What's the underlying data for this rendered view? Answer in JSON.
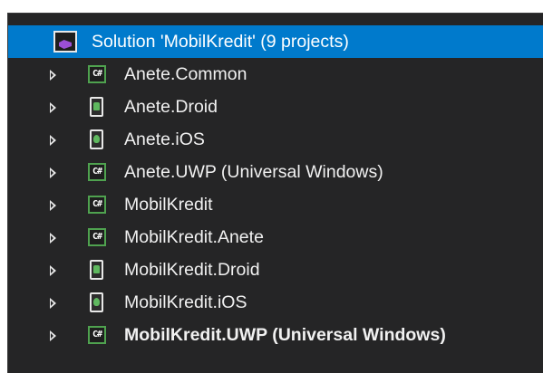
{
  "solution": {
    "label": "Solution 'MobilKredit' (9 projects)",
    "icon": "visual-studio-solution-icon"
  },
  "projects": [
    {
      "label": "Anete.Common",
      "icon": "csharp-project-icon",
      "bold": false
    },
    {
      "label": "Anete.Droid",
      "icon": "android-project-icon",
      "bold": false
    },
    {
      "label": "Anete.iOS",
      "icon": "ios-project-icon",
      "bold": false
    },
    {
      "label": "Anete.UWP (Universal Windows)",
      "icon": "csharp-project-icon",
      "bold": false
    },
    {
      "label": "MobilKredit",
      "icon": "csharp-project-icon",
      "bold": false
    },
    {
      "label": "MobilKredit.Anete",
      "icon": "csharp-project-icon",
      "bold": false
    },
    {
      "label": "MobilKredit.Droid",
      "icon": "android-project-icon",
      "bold": false
    },
    {
      "label": "MobilKredit.iOS",
      "icon": "ios-project-icon",
      "bold": false
    },
    {
      "label": "MobilKredit.UWP (Universal Windows)",
      "icon": "csharp-project-icon",
      "bold": true
    }
  ],
  "icon_text": {
    "csharp": "C#"
  },
  "colors": {
    "background": "#252526",
    "selection": "#007acc",
    "text": "#f1f1f1",
    "csharp_border": "#4fa24f"
  }
}
